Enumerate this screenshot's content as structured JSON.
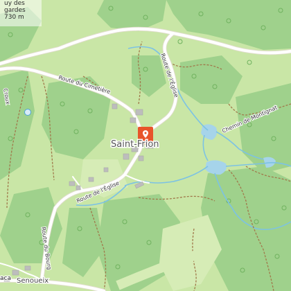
{
  "place": {
    "name": "Saint-Frion",
    "marker_color": "#e8542a"
  },
  "corner_label": {
    "line1": "uy des",
    "line2": "gardes",
    "line3": "730 m"
  },
  "roads": {
    "cimetiere": "Route du Cimetière",
    "eglise_north": "Route de l'Église",
    "eglise_south": "Route de l'Église",
    "bourg": "Route du Bourg",
    "montignat": "Chemin de Montignat",
    "croux": "Croux"
  },
  "villages": {
    "senoueix": "Senoueix",
    "edge": "aca"
  },
  "colors": {
    "meadow": "#c9e6a6",
    "forest": "#9cd08a",
    "road": "#ffffff",
    "water": "#a6d4ea",
    "stream": "#7cc2e4",
    "trail": "#a0784a",
    "building": "#bcbcbc"
  }
}
